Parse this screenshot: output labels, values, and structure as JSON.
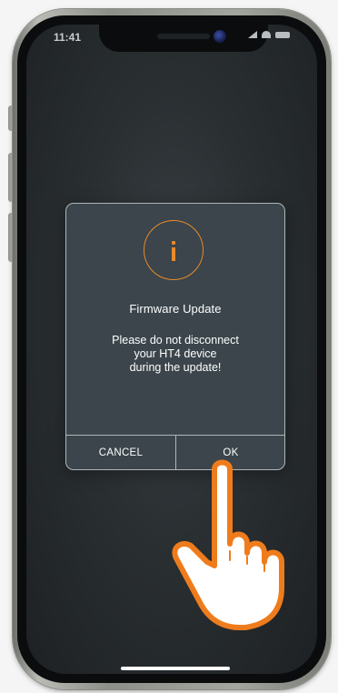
{
  "status_bar": {
    "time": "11:41",
    "icons": [
      "signal-icon",
      "wifi-icon",
      "battery-icon"
    ]
  },
  "dialog": {
    "icon": "info-icon",
    "title": "Firmware Update",
    "message_lines": [
      "Please do not disconnect",
      "your HT4 device",
      "during the update!"
    ],
    "cancel_label": "CANCEL",
    "ok_label": "OK"
  },
  "overlay": {
    "gesture": "tap-hand-icon"
  },
  "colors": {
    "accent": "#e88a2c",
    "dialog_background": "#3b454b",
    "dialog_border": "#aeb6ba",
    "screen_background": "#2a2f32",
    "text": "#ffffff",
    "hand_fill": "#ffffff",
    "hand_outline": "#ef7c1c"
  }
}
